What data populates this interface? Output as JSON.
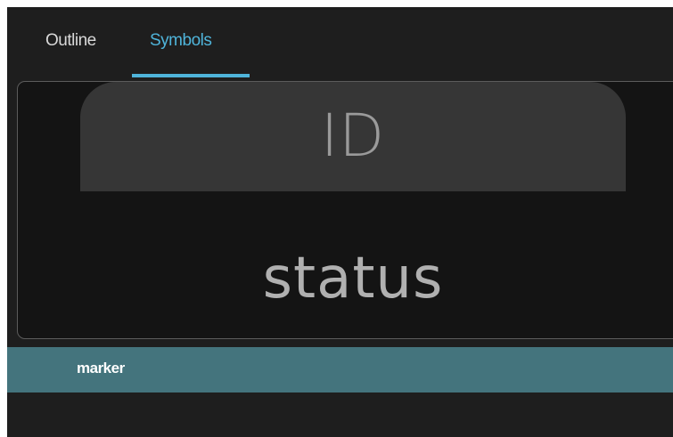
{
  "tabs": [
    {
      "label": "Outline",
      "active": false
    },
    {
      "label": "Symbols",
      "active": true
    }
  ],
  "symbol_card": {
    "header": "ID",
    "value": "status"
  },
  "list": {
    "selected_item": "marker"
  },
  "colors": {
    "accent": "#4fb4da",
    "panel_bg": "#1e1e1e",
    "card_bg": "#141414",
    "header_bg": "#363636",
    "selection": "#44747d"
  }
}
